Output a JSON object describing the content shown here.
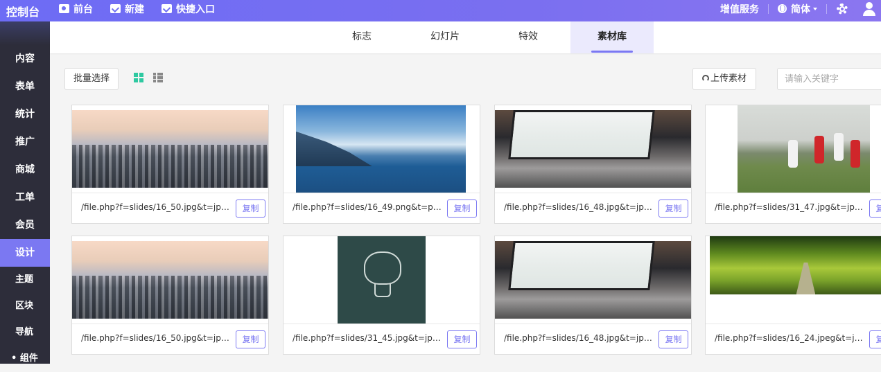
{
  "app": {
    "logo": "控制台"
  },
  "topnav": {
    "frontend": "前台",
    "new": "新建",
    "shortcut": "快捷入口"
  },
  "topright": {
    "services": "增值服务",
    "language": "简体"
  },
  "sidebar": {
    "items": [
      "内容",
      "表单",
      "统计",
      "推广",
      "商城",
      "工单",
      "会员",
      "设计"
    ],
    "active": "设计",
    "subitems": [
      "主题",
      "区块",
      "导航",
      "• 组件"
    ]
  },
  "tabs": [
    "标志",
    "幻灯片",
    "特效",
    "素材库"
  ],
  "active_tab": "素材库",
  "toolbar": {
    "batch_select": "批量选择",
    "upload": "上传素材",
    "search_placeholder": "请输入关键字"
  },
  "copy_label": "复制",
  "cards": [
    {
      "path": "/file.php?f=slides/16_50.jpg&t=jpg...",
      "image": "city-skyline"
    },
    {
      "path": "/file.php?f=slides/16_49.png&t=pn...",
      "image": "lake-castle"
    },
    {
      "path": "/file.php?f=slides/16_48.jpg&t=jpg...",
      "image": "laptop-dashboard"
    },
    {
      "path": "/file.php?f=slides/31_47.jpg&t=jpg...",
      "image": "soccer-players"
    },
    {
      "path": "/file.php?f=slides/16_50.jpg&t=jpg...",
      "image": "city-skyline"
    },
    {
      "path": "/file.php?f=slides/31_45.jpg&t=jpg...",
      "image": "brain-bulb"
    },
    {
      "path": "/file.php?f=slides/16_48.jpg&t=jpg...",
      "image": "laptop-dashboard"
    },
    {
      "path": "/file.php?f=slides/16_24.jpeg&t=jp...",
      "image": "tree-tunnel"
    }
  ],
  "colors": {
    "accent": "#7b78f2",
    "sidebar": "#2d2d3a",
    "grid_icon": "#2ec9a1"
  }
}
